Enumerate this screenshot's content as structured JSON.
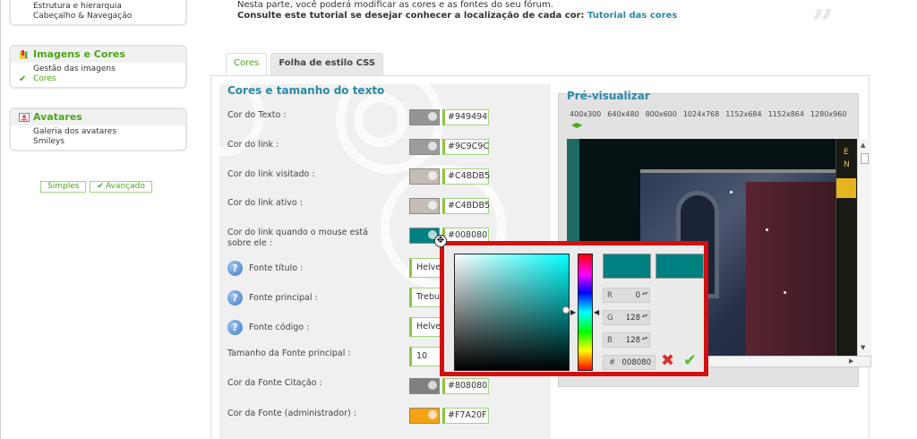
{
  "sidebar": {
    "box1": {
      "items": [
        "Estrutura e hierarquia",
        "Cabeçalho & Navegação"
      ]
    },
    "box2": {
      "title": "Imagens e Cores",
      "items": [
        "Gestão das imagens",
        "Cores"
      ],
      "active_index": 1
    },
    "box3": {
      "title": "Avatares",
      "items": [
        "Galeria dos avatares",
        "Smileys"
      ]
    },
    "modes": {
      "simple": "Simples",
      "advanced": "Avançado"
    }
  },
  "intro": {
    "line1": "Nesta parte, você poderá modificar as cores e as fontes do seu fórum.",
    "line2_prefix": "Consulte este tutorial se desejar conhecer a localização de cada cor: ",
    "line2_link": "Tutorial das cores"
  },
  "tabs": [
    {
      "label": "Cores",
      "active": true
    },
    {
      "label": "Folha de estilo CSS",
      "active": false
    }
  ],
  "section_title": "Cores e tamanho do texto",
  "rows": {
    "text_color": {
      "label": "Cor do Texto   :",
      "value": "#949494",
      "color": "#949494"
    },
    "link_color": {
      "label": "Cor do link   :",
      "value": "#9C9C9C",
      "color": "#9C9C9C"
    },
    "visited_link": {
      "label": "Cor do link visitado   :",
      "value": "#C4BDB5",
      "color": "#C4BDB5"
    },
    "active_link": {
      "label": "Cor do link ativo   :",
      "value": "#C4BDB5",
      "color": "#C4BDB5"
    },
    "hover_link_1": "Cor do link quando o mouse está",
    "hover_link_2": "sobre ele   :",
    "hover_link": {
      "value": "#008080",
      "color": "#008080"
    },
    "title_font": {
      "label": "Fonte título   :",
      "value": "Helvet"
    },
    "main_font": {
      "label": "Fonte principal   :",
      "value": "Trebu"
    },
    "code_font": {
      "label": "Fonte código   :",
      "value": "Helvet"
    },
    "main_font_size": {
      "label": "Tamanho da Fonte principal   :",
      "value": "10"
    },
    "quote_font_color": {
      "label": "Cor da Fonte Citação   :",
      "value": "#808080",
      "color": "#808080"
    },
    "admin_font_color": {
      "label": "Cor da Fonte (administrador)   :",
      "value": "#F7A20F",
      "color": "#F7A20F"
    }
  },
  "preview": {
    "title": "Pré-visualizar",
    "resolutions": [
      "400x300",
      "640x480",
      "800x600",
      "1024x768",
      "1152x684",
      "1152x864",
      "1280x960"
    ],
    "side_letters": [
      "E",
      "N"
    ]
  },
  "picker": {
    "r_label": "R",
    "r_value": "0",
    "g_label": "G",
    "g_value": "128",
    "b_label": "B",
    "b_value": "128",
    "hex_label": "#",
    "hex_value": "008080",
    "color": "#008080"
  }
}
